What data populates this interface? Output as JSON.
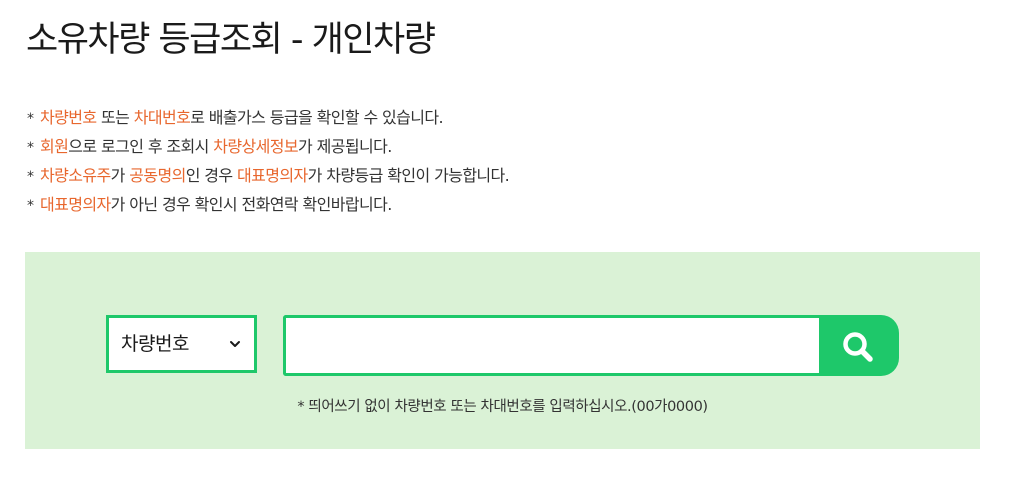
{
  "page": {
    "title": "소유차량 등급조회 - 개인차량"
  },
  "notices": [
    {
      "bullet": "*",
      "parts": [
        {
          "text": "차량번호",
          "highlight": true
        },
        {
          "text": " 또는 ",
          "highlight": false
        },
        {
          "text": "차대번호",
          "highlight": true
        },
        {
          "text": "로 배출가스 등급을 확인할 수 있습니다.",
          "highlight": false
        }
      ]
    },
    {
      "bullet": "*",
      "parts": [
        {
          "text": "회원",
          "highlight": true
        },
        {
          "text": "으로 로그인 후 조회시 ",
          "highlight": false
        },
        {
          "text": "차량상세정보",
          "highlight": true
        },
        {
          "text": "가 제공됩니다.",
          "highlight": false
        }
      ]
    },
    {
      "bullet": "*",
      "parts": [
        {
          "text": "차량소유주",
          "highlight": true
        },
        {
          "text": "가 ",
          "highlight": false
        },
        {
          "text": "공동명의",
          "highlight": true
        },
        {
          "text": "인 경우 ",
          "highlight": false
        },
        {
          "text": "대표명의자",
          "highlight": true
        },
        {
          "text": "가 차량등급 확인이 가능합니다.",
          "highlight": false
        }
      ]
    },
    {
      "bullet": "*",
      "parts": [
        {
          "text": "대표명의자",
          "highlight": true
        },
        {
          "text": "가 아닌 경우 확인시 전화연락 확인바랍니다.",
          "highlight": false
        }
      ]
    }
  ],
  "search": {
    "select_value": "차량번호",
    "input_value": "",
    "input_placeholder": "",
    "button_icon": "search-icon",
    "hint": "* 띄어쓰기 없이 차량번호 또는 차대번호를 입력하십시오.(00가0000)"
  },
  "colors": {
    "highlight": "#e8672e",
    "accent": "#1ec86a",
    "panel_background": "#daf2d6"
  }
}
